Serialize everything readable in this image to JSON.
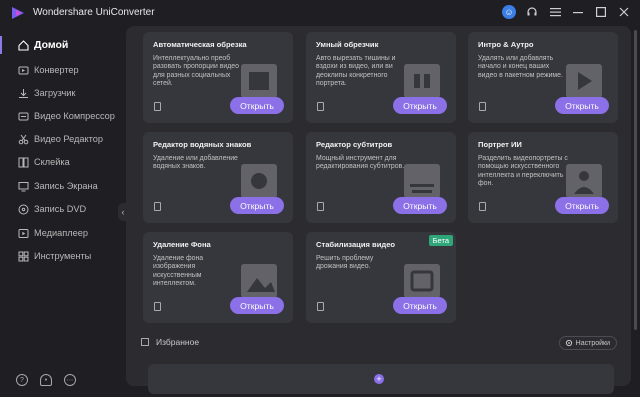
{
  "app": {
    "title": "Wondershare UniConverter"
  },
  "titlebar": {
    "icons": [
      "user-avatar-icon",
      "headset-icon",
      "menu-icon",
      "minimize-icon",
      "maximize-icon",
      "close-icon"
    ]
  },
  "sidebar": {
    "items": [
      {
        "label": "Домой",
        "icon": "home-icon",
        "active": true
      },
      {
        "label": "Конвертер",
        "icon": "converter-icon"
      },
      {
        "label": "Загрузчик",
        "icon": "download-icon"
      },
      {
        "label": "Видео Компрессор",
        "icon": "compress-icon"
      },
      {
        "label": "Видео Редактор",
        "icon": "scissors-icon"
      },
      {
        "label": "Склейка",
        "icon": "merge-icon"
      },
      {
        "label": "Запись Экрана",
        "icon": "screen-record-icon"
      },
      {
        "label": "Запись DVD",
        "icon": "disc-icon"
      },
      {
        "label": "Медиаплеер",
        "icon": "player-icon"
      },
      {
        "label": "Инструменты",
        "icon": "grid-icon"
      }
    ],
    "bottom_icons": [
      "help-icon",
      "bell-icon",
      "feedback-icon"
    ]
  },
  "cards": [
    {
      "title": "Автоматическая обрезка",
      "desc": "Интеллектуально преоб разовать пропорции видео для разных социальных сетей.",
      "button": "Открыть",
      "art": "crop-art"
    },
    {
      "title": "Умный обрезчик",
      "desc": "Авто вырезать тишины и вздохи из видео,  или ви деоклипы конкретного портрета.",
      "button": "Открыть",
      "art": "ai-art"
    },
    {
      "title": "Интро & Аутро",
      "desc": "Удалять или добавлять начало и конец ваших видео в пакетном режиме.",
      "button": "Открыть",
      "art": "intro-art"
    },
    {
      "title": "Редактор водяных знаков",
      "desc": "Удаление или добавление водяных знаков.",
      "button": "Открыть",
      "art": "watermark-art"
    },
    {
      "title": "Редактор субтитров",
      "desc": "Мощный инструмент для редактирования субтитров.",
      "button": "Открыть",
      "art": "subtitle-art"
    },
    {
      "title": "Портрет ИИ",
      "desc": "Разделить видеопортреты с помощью искусственного интеллекта и переключить фон.",
      "button": "Открыть",
      "art": "portrait-art"
    },
    {
      "title": "Удаление Фона",
      "desc": "Удаление фона изображения искусственным интеллектом.",
      "button": "Открыть",
      "art": "bg-remove-art"
    },
    {
      "title": "Стабилизация видео",
      "desc": "Решить проблему дрожания видео.",
      "button": "Открыть",
      "art": "stabilize-art",
      "badge": "Бета"
    }
  ],
  "favorites": {
    "label": "Избранное",
    "settings_label": "Настройки",
    "add": "+"
  },
  "colors": {
    "accent": "#8b70e8",
    "beta": "#2fa57a",
    "background": "#1f1f23",
    "panel": "#2b2b30",
    "card": "#36363d"
  }
}
